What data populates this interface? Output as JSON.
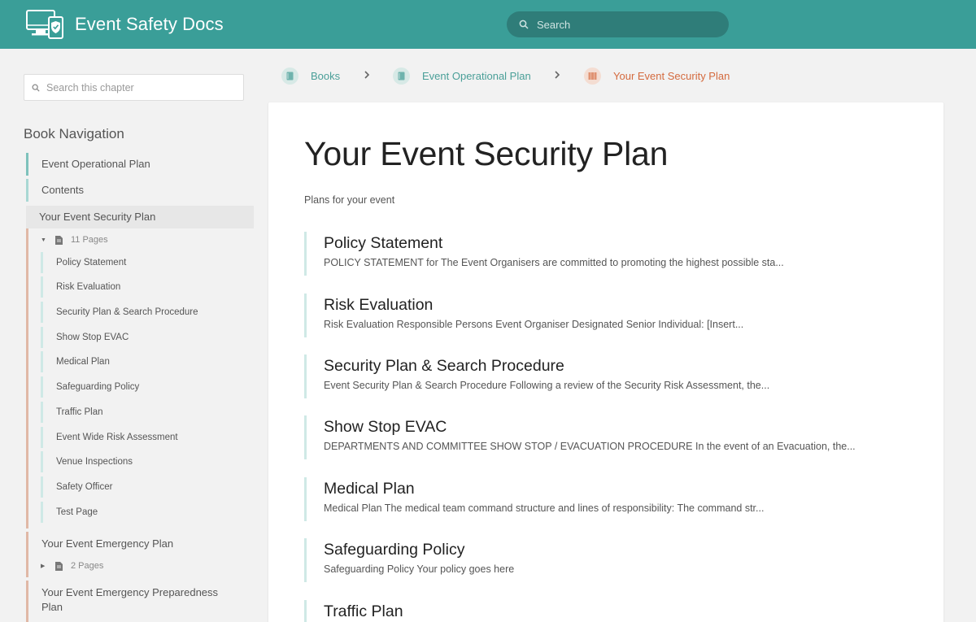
{
  "app": {
    "title": "Event Safety Docs"
  },
  "header": {
    "search_placeholder": "Search"
  },
  "sidebar": {
    "search_placeholder": "Search this chapter",
    "heading": "Book Navigation",
    "items": [
      {
        "label": "Event Operational Plan"
      },
      {
        "label": "Contents"
      },
      {
        "label": "Your Event Security Plan"
      },
      {
        "label": "Your Event Emergency Plan"
      },
      {
        "label": "Your Event Emergency Preparedness Plan"
      }
    ],
    "security_pages_count": "11 Pages",
    "emergency_pages_count": "2 Pages",
    "pages": [
      {
        "label": "Policy Statement"
      },
      {
        "label": "Risk Evaluation"
      },
      {
        "label": "Security Plan & Search Procedure"
      },
      {
        "label": "Show Stop EVAC"
      },
      {
        "label": "Medical Plan"
      },
      {
        "label": "Safeguarding Policy"
      },
      {
        "label": "Traffic Plan"
      },
      {
        "label": "Event Wide Risk Assessment"
      },
      {
        "label": "Venue Inspections"
      },
      {
        "label": "Safety Officer"
      },
      {
        "label": "Test Page"
      }
    ]
  },
  "breadcrumb": [
    {
      "label": "Books"
    },
    {
      "label": "Event Operational Plan"
    },
    {
      "label": "Your Event Security Plan"
    }
  ],
  "main": {
    "title": "Your Event Security Plan",
    "description": "Plans for your event",
    "entries": [
      {
        "title": "Policy Statement",
        "excerpt": "POLICY STATEMENT for The Event Organisers are committed to promoting the highest possible sta..."
      },
      {
        "title": "Risk Evaluation",
        "excerpt": "Risk Evaluation Responsible Persons Event Organiser Designated Senior Individual: [Insert..."
      },
      {
        "title": "Security Plan & Search Procedure",
        "excerpt": "Event Security Plan & Search Procedure Following a review of the Security Risk Assessment, the..."
      },
      {
        "title": "Show Stop EVAC",
        "excerpt": "DEPARTMENTS AND COMMITTEE SHOW STOP / EVACUATION PROCEDURE  In the event of an Evacuation, the..."
      },
      {
        "title": "Medical Plan",
        "excerpt": "Medical Plan The medical team command structure and lines of responsibility:  The command str..."
      },
      {
        "title": "Safeguarding Policy",
        "excerpt": "Safeguarding Policy Your policy goes here"
      },
      {
        "title": "Traffic Plan",
        "excerpt": ""
      }
    ]
  },
  "colors": {
    "header": "#3a9e98",
    "accent_green": "#4a9f98",
    "accent_orange": "#d46a3e"
  },
  "icons": [
    "logo-devices-shield-icon",
    "search-icon",
    "book-icon",
    "document-icon",
    "chevron-right-icon",
    "caret-down-icon",
    "caret-right-icon"
  ]
}
